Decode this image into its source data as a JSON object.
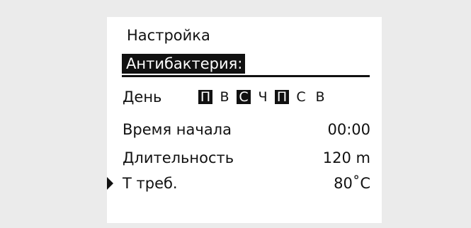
{
  "menu": {
    "title": "Настройка",
    "submenu_title": "Антибактерия:"
  },
  "days_row": {
    "label": "День",
    "days": [
      {
        "label": "П",
        "active": true
      },
      {
        "label": "В",
        "active": false
      },
      {
        "label": "С",
        "active": true
      },
      {
        "label": "Ч",
        "active": false
      },
      {
        "label": "П",
        "active": true
      },
      {
        "label": "С",
        "active": false
      },
      {
        "label": "В",
        "active": false
      }
    ]
  },
  "settings": [
    {
      "label": "Время начала",
      "value": "00:00"
    },
    {
      "label": "Длительность",
      "value": "120 m"
    },
    {
      "label": "Т треб.",
      "value": "80˚C"
    }
  ],
  "selection": {
    "cursor_icon": "triangle-right-icon",
    "selected_item": "Т треб."
  },
  "colors": {
    "background": "#ebebeb",
    "display": "#ffffff",
    "foreground": "#111111"
  }
}
